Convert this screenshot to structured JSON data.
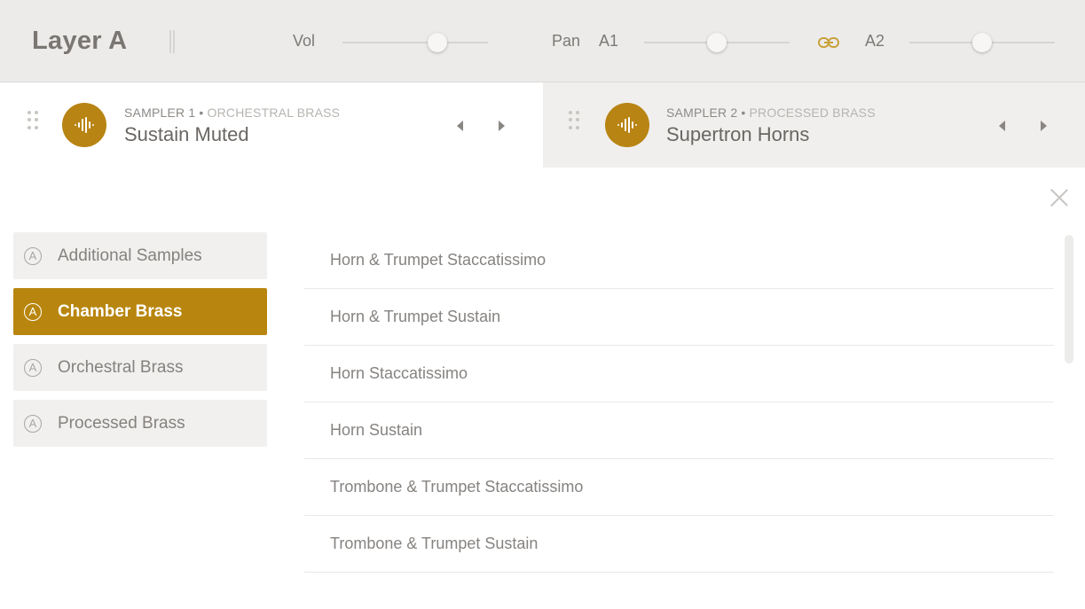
{
  "header": {
    "title": "Layer A",
    "vol_label": "Vol",
    "pan_label": "Pan",
    "a1_label": "A1",
    "a2_label": "A2",
    "vol_value": 0.62,
    "a1_value": 0.5,
    "a2_value": 0.5,
    "link_icon": "link-icon",
    "link_color": "#c9a13a"
  },
  "samplers": [
    {
      "label": "SAMPLER 1",
      "category": "ORCHESTRAL BRASS",
      "name": "Sustain Muted",
      "icon": "waveform-icon"
    },
    {
      "label": "SAMPLER 2",
      "category": "PROCESSED BRASS",
      "name": "Supertron Horns",
      "icon": "waveform-icon"
    }
  ],
  "categories": [
    {
      "badge": "A",
      "label": "Additional Samples",
      "active": false
    },
    {
      "badge": "A",
      "label": "Chamber Brass",
      "active": true
    },
    {
      "badge": "A",
      "label": "Orchestral Brass",
      "active": false
    },
    {
      "badge": "A",
      "label": "Processed Brass",
      "active": false
    }
  ],
  "presets": [
    "Horn & Trumpet Staccatissimo",
    "Horn & Trumpet Sustain",
    "Horn Staccatissimo",
    "Horn Sustain",
    "Trombone & Trumpet Staccatissimo",
    "Trombone & Trumpet Sustain"
  ],
  "colors": {
    "accent": "#b8860e",
    "header_bg": "#ecebea"
  }
}
